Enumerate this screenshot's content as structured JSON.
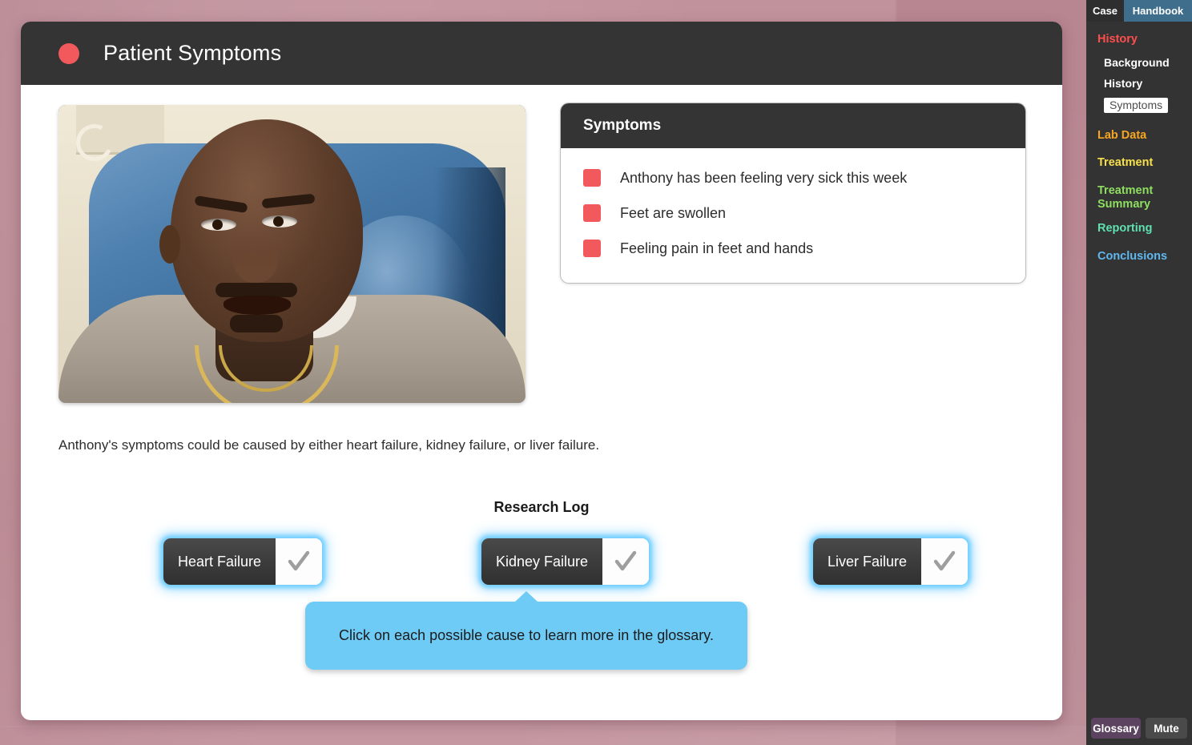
{
  "card": {
    "title": "Patient Symptoms",
    "rec_icon": "record-dot-icon"
  },
  "photo": {
    "alt": "Patient seated in a blue medical examination chair"
  },
  "symptoms_panel": {
    "header": "Symptoms",
    "items": [
      "Anthony has been feeling very sick this week",
      "Feet are swollen",
      "Feeling pain in feet and hands"
    ]
  },
  "narrative": "Anthony's symptoms could be caused by either heart failure, kidney failure, or liver failure.",
  "research_log": {
    "title": "Research Log",
    "causes": [
      {
        "label": "Heart Failure",
        "checked": false
      },
      {
        "label": "Kidney Failure",
        "checked": false
      },
      {
        "label": "Liver Failure",
        "checked": false
      }
    ]
  },
  "callout": {
    "text": "Click on each possible cause to learn more in the glossary."
  },
  "sidebar": {
    "tabs": [
      {
        "label": "Case",
        "active": true
      },
      {
        "label": "Handbook",
        "active": false
      }
    ],
    "nav": [
      {
        "label": "History",
        "color": "#ff4d4d",
        "type": "section"
      },
      {
        "label": "Background",
        "type": "sub",
        "selected": false
      },
      {
        "label": "History",
        "type": "sub",
        "selected": false
      },
      {
        "label": "Symptoms",
        "type": "sub",
        "selected": true
      },
      {
        "label": "Lab Data",
        "color": "#f6a623",
        "type": "section"
      },
      {
        "label": "Treatment",
        "color": "#f7e04b",
        "type": "section"
      },
      {
        "label": "Treatment Summary",
        "color": "#8ede60",
        "type": "section"
      },
      {
        "label": "Reporting",
        "color": "#5fe0b0",
        "type": "section"
      },
      {
        "label": "Conclusions",
        "color": "#5fb8f0",
        "type": "section"
      }
    ],
    "bottom_buttons": [
      {
        "label": "Glossary"
      },
      {
        "label": "Mute"
      }
    ]
  },
  "colors": {
    "page_background": "#c08e98",
    "header_bar": "#343434",
    "accent_red": "#f1595c",
    "callout_blue": "#6ecbf5",
    "glow_blue": "#5fc8ff",
    "sidebar_bg": "#333333",
    "handbook_tab": "#3f6d8c",
    "glossary_btn": "#5c4360"
  }
}
